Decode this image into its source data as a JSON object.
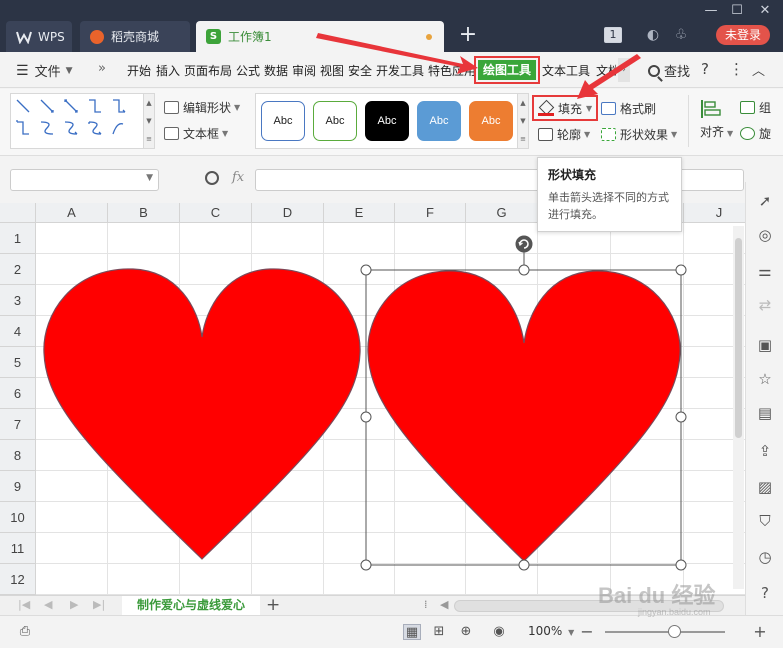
{
  "tabs": {
    "wps": "WPS",
    "store": "稻壳商城",
    "workbook": "工作簿1",
    "book_icon_letter": "S"
  },
  "titlebar": {
    "count_badge": "1",
    "login_label": "未登录"
  },
  "menu": {
    "file": "文件",
    "more": "»",
    "items": [
      "开始",
      "插入",
      "页面布局",
      "公式",
      "数据",
      "审阅",
      "视图",
      "安全",
      "开发工具",
      "特色应用"
    ],
    "active": "绘图工具",
    "after_active": [
      "文本工具",
      "文档"
    ],
    "search": "查找"
  },
  "ribbon": {
    "edit_shape": "编辑形状",
    "text_box": "文本框",
    "style_label": "Abc",
    "styles": [
      {
        "bg": "#ffffff",
        "border": "#4a78c2",
        "text": "#222222"
      },
      {
        "bg": "#ffffff",
        "border": "#5aab3c",
        "text": "#222222"
      },
      {
        "bg": "#000000",
        "border": "#000000",
        "text": "#ffffff"
      },
      {
        "bg": "#5b9bd5",
        "border": "#5b9bd5",
        "text": "#ffffff"
      },
      {
        "bg": "#ed7d31",
        "border": "#ed7d31",
        "text": "#ffffff"
      }
    ],
    "fill": "填充",
    "outline": "轮廓",
    "format_painter": "格式刷",
    "shape_effects": "形状效果",
    "align": "对齐",
    "group_partial": "组",
    "rotate_partial": "旋"
  },
  "tooltip": {
    "title": "形状填充",
    "description": "单击箭头选择不同的方式进行填充。"
  },
  "formula": {
    "fx": "fx"
  },
  "grid": {
    "columns": [
      "A",
      "B",
      "C",
      "D",
      "E",
      "F",
      "G",
      "H",
      "I",
      "J"
    ],
    "rows": [
      "1",
      "2",
      "3",
      "4",
      "5",
      "6",
      "7",
      "8",
      "9",
      "10",
      "11",
      "12"
    ]
  },
  "shapes": {
    "heart_fill": "#ff0000",
    "heart_outline": "#7a4a5a",
    "selection_color": "#555555"
  },
  "sheets": {
    "active": "制作爱心与虚线爱心",
    "add": "+"
  },
  "status": {
    "zoom": "100%",
    "minus": "−",
    "plus": "+"
  },
  "annotation": {
    "arrow_color": "#e8353a"
  },
  "watermark": {
    "brand": "Bai du 经验",
    "site": "jingyan.baidu.com"
  }
}
